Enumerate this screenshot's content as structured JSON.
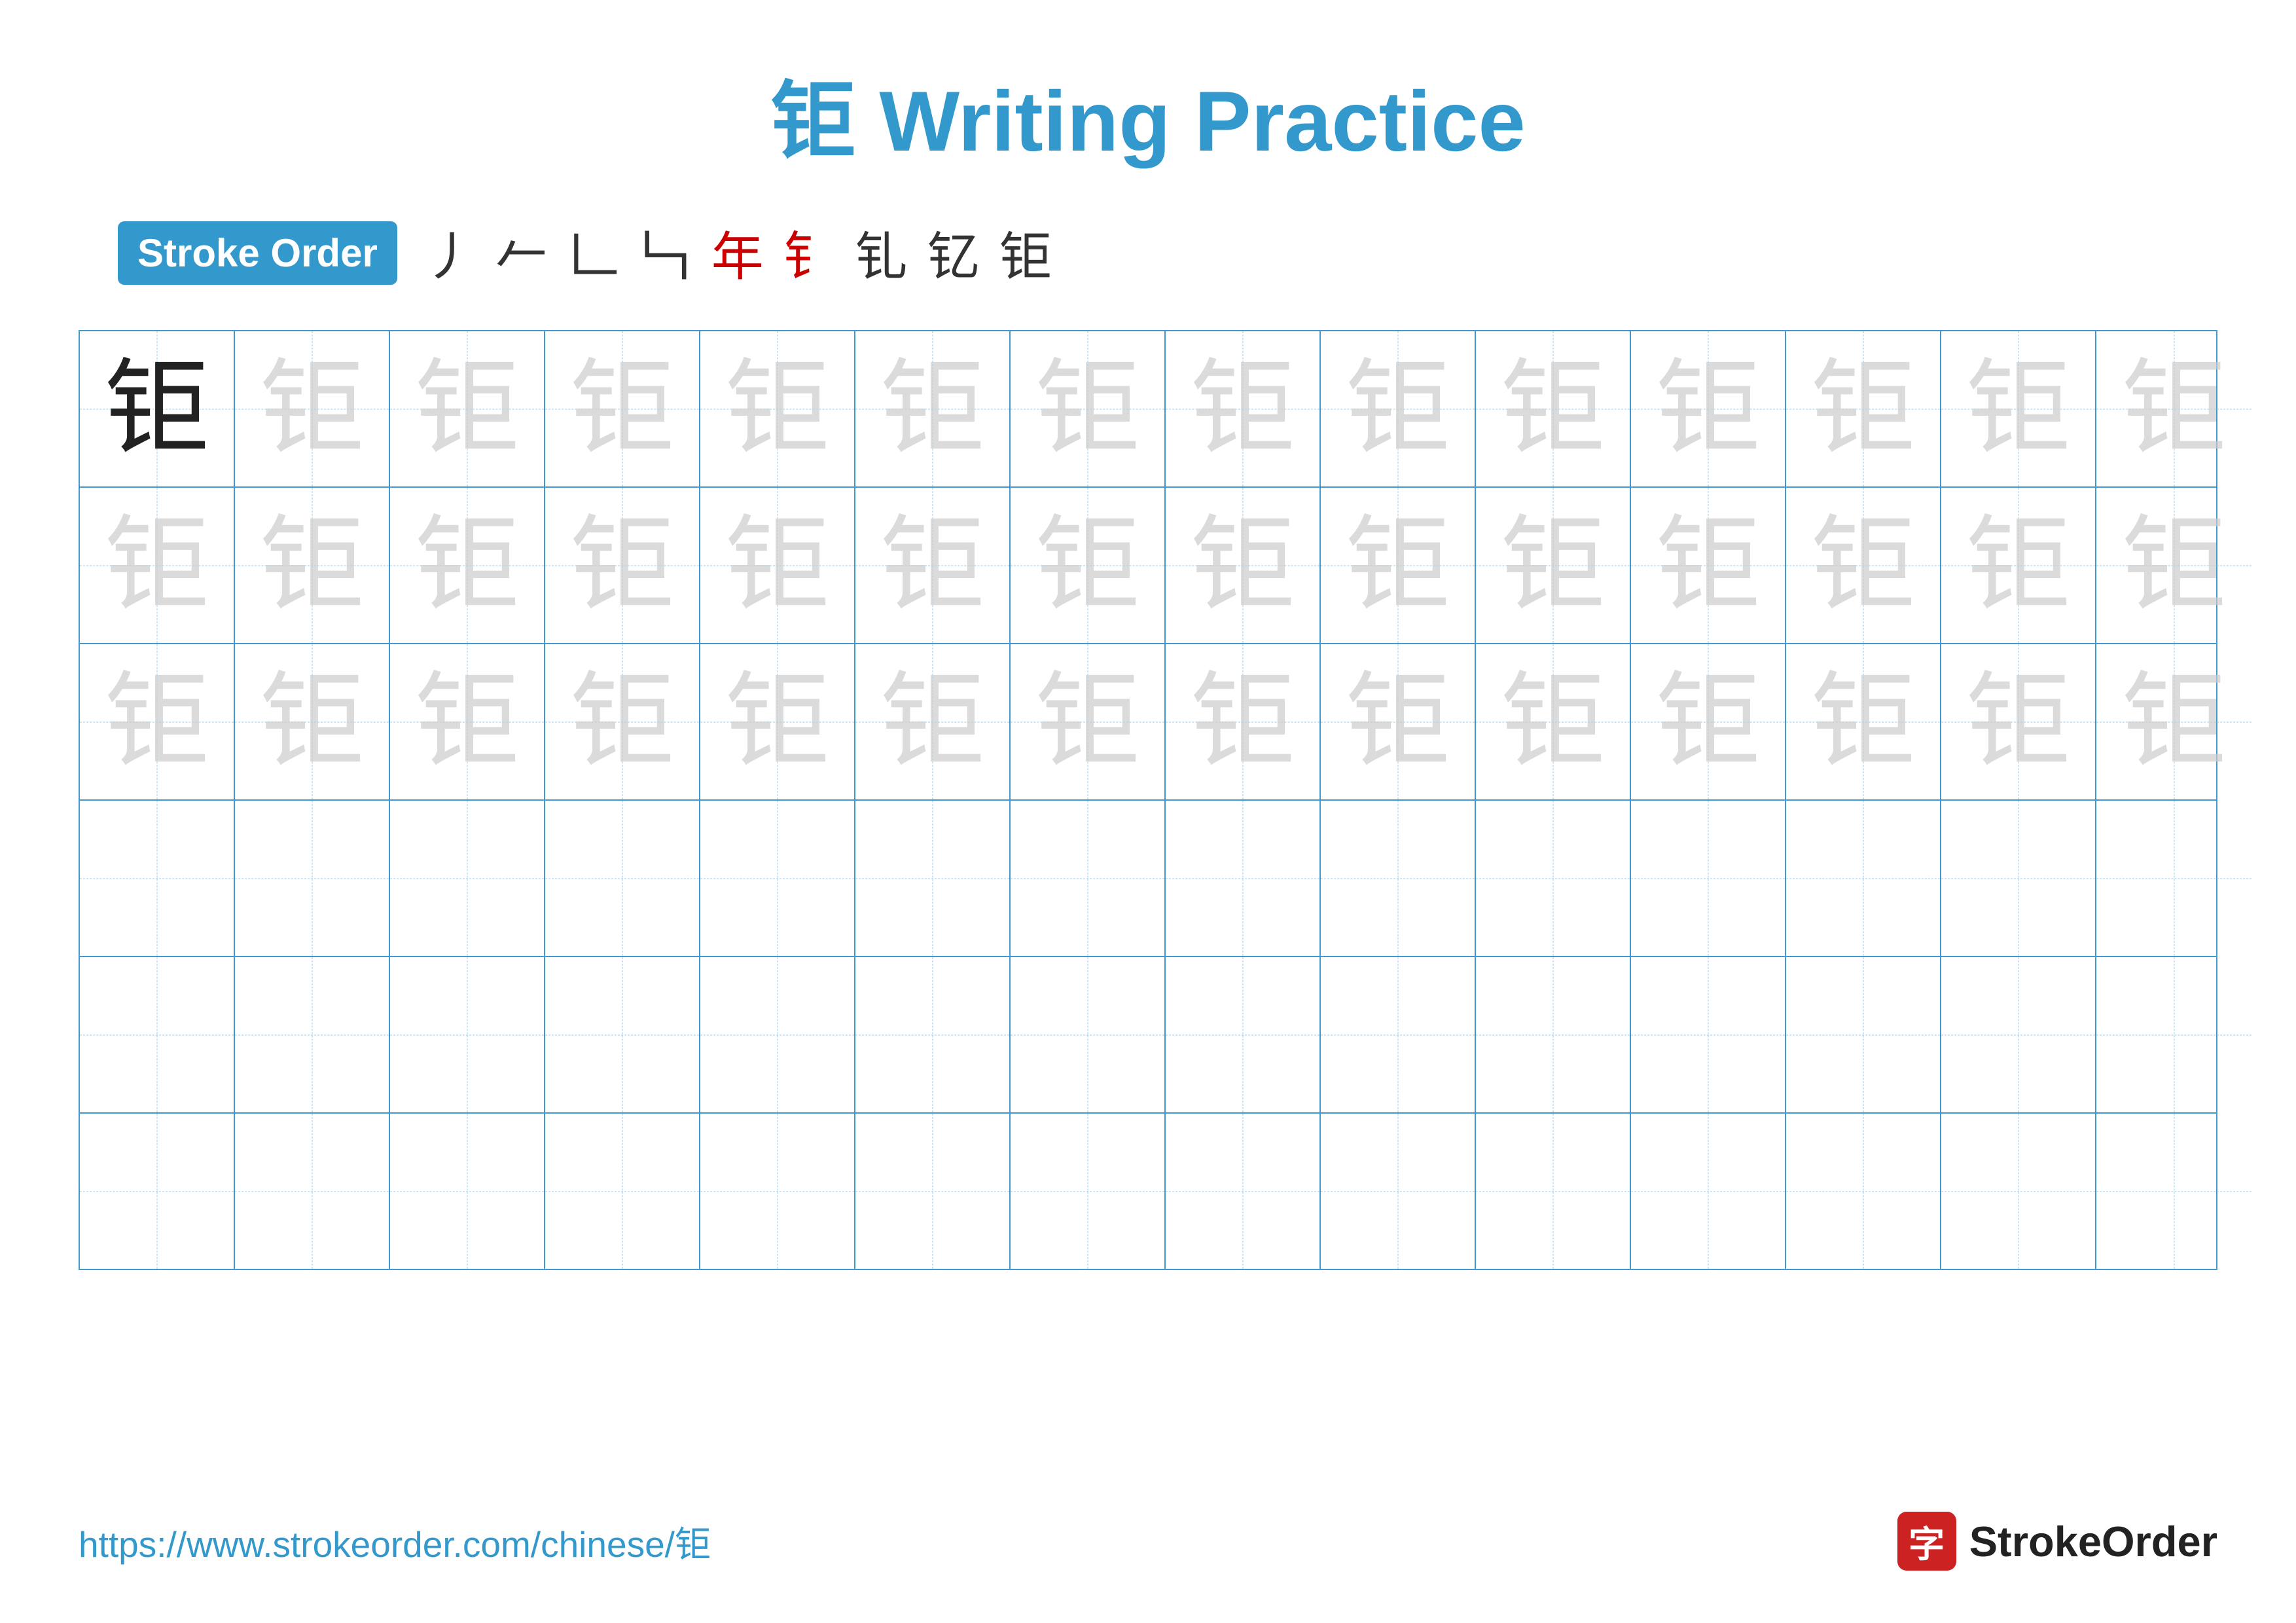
{
  "title": "钜 Writing Practice",
  "stroke_order": {
    "badge_label": "Stroke Order",
    "strokes": [
      "丿",
      "𠂉",
      "𠃊",
      "𠃑",
      "年",
      "钅",
      "钆",
      "钇",
      "钜"
    ]
  },
  "character": "钜",
  "grid": {
    "rows": 6,
    "cols": 14,
    "filled_rows": 3
  },
  "footer": {
    "url": "https://www.strokeorder.com/chinese/钜",
    "logo_char": "字",
    "logo_text": "StrokeOrder"
  }
}
